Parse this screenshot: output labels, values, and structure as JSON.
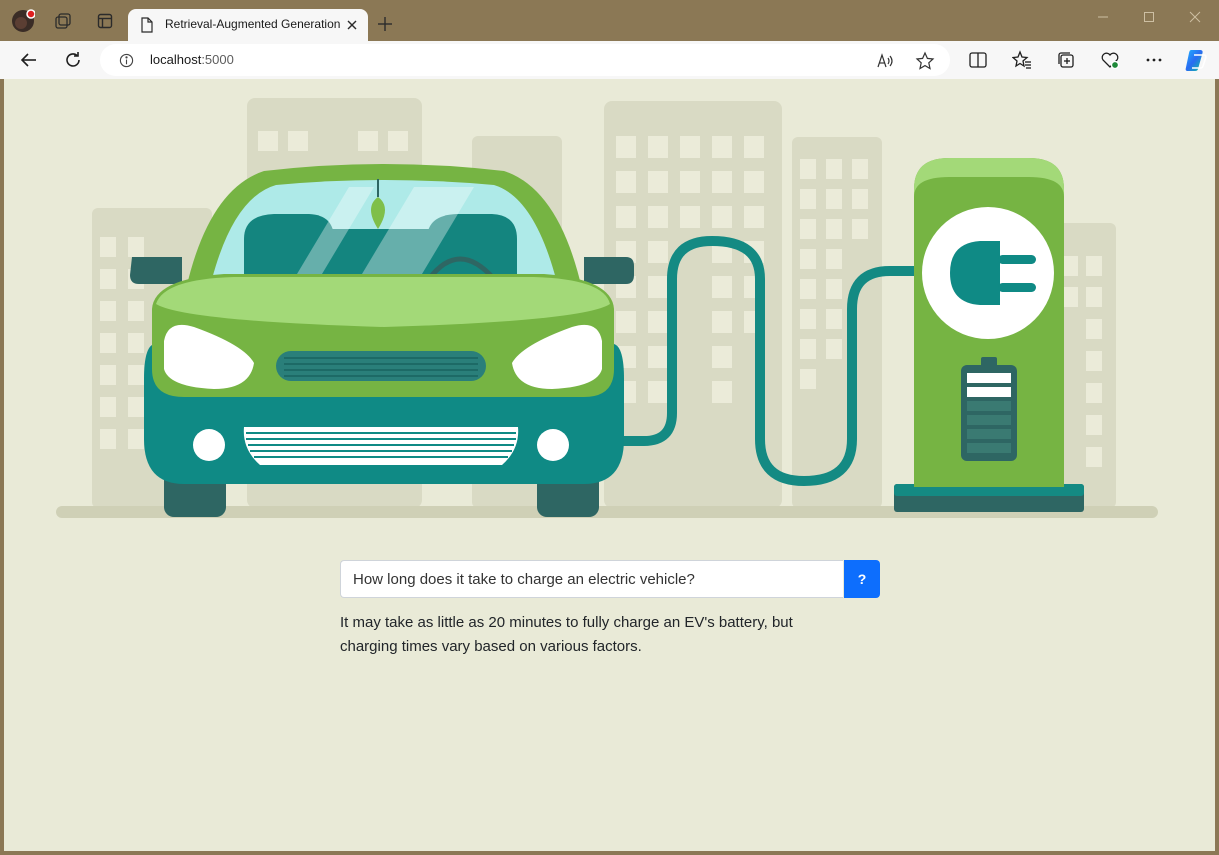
{
  "browser": {
    "tab_title": "Retrieval-Augmented Generation",
    "url_host": "localhost",
    "url_port": ":5000"
  },
  "search": {
    "value": "How long does it take to charge an electric vehicle?",
    "button_label": "?"
  },
  "answer": {
    "text": "It may take as little as 20 minutes to fully charge an EV's battery, but charging times vary based on various factors."
  },
  "colors": {
    "background": "#e9ead7",
    "accent": "#0d6efd",
    "car_green": "#77b543",
    "car_teal": "#0f8a85"
  },
  "icons": [
    "profile-avatar-icon",
    "workspaces-icon",
    "tab-actions-icon",
    "page-icon",
    "close-icon",
    "new-tab-icon",
    "minimize-icon",
    "maximize-icon",
    "window-close-icon",
    "back-icon",
    "refresh-icon",
    "site-info-icon",
    "read-aloud-icon",
    "favorite-star-icon",
    "split-screen-icon",
    "favorites-icon",
    "collections-icon",
    "browser-essentials-icon",
    "more-icon",
    "copilot-icon"
  ]
}
